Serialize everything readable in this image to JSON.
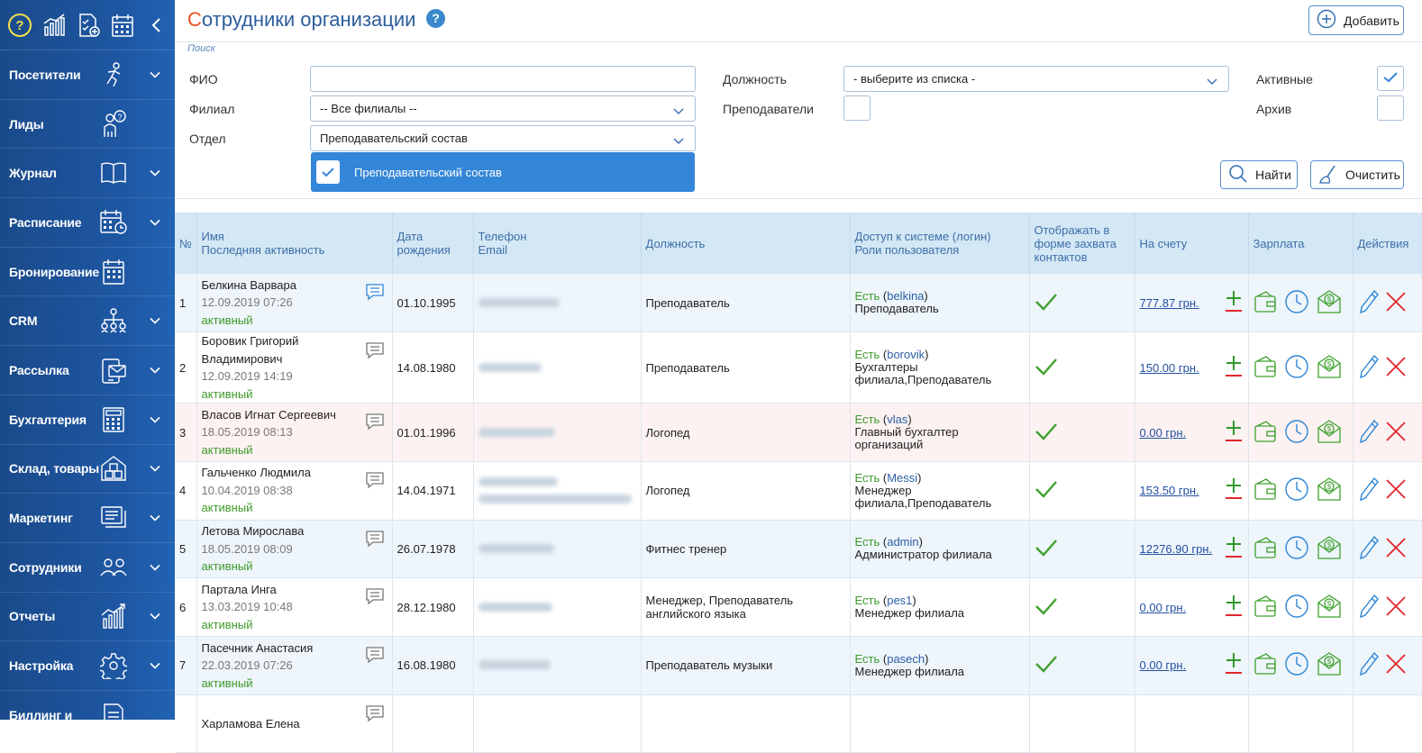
{
  "sidebar": {
    "items": [
      {
        "label": "Посетители",
        "icon": "visitor-icon",
        "chevron": true
      },
      {
        "label": "Лиды",
        "icon": "lead-icon",
        "chevron": false
      },
      {
        "label": "Журнал",
        "icon": "book-icon",
        "chevron": true
      },
      {
        "label": "Расписание",
        "icon": "schedule-icon",
        "chevron": true
      },
      {
        "label": "Бронирование",
        "icon": "booking-icon",
        "chevron": false
      },
      {
        "label": "CRM",
        "icon": "crm-icon",
        "chevron": true
      },
      {
        "label": "Рассылка",
        "icon": "mailing-icon",
        "chevron": true
      },
      {
        "label": "Бухгалтерия",
        "icon": "calculator-icon",
        "chevron": true
      },
      {
        "label": "Склад, товары",
        "icon": "warehouse-icon",
        "chevron": true
      },
      {
        "label": "Маркетинг",
        "icon": "marketing-icon",
        "chevron": true
      },
      {
        "label": "Сотрудники",
        "icon": "staff-icon",
        "chevron": true
      },
      {
        "label": "Отчеты",
        "icon": "reports-icon",
        "chevron": true
      },
      {
        "label": "Настройка",
        "icon": "settings-gear-icon",
        "chevron": true
      },
      {
        "label": "Биллинг и",
        "icon": "billing-icon",
        "chevron": false
      }
    ]
  },
  "header": {
    "title_first": "С",
    "title_rest": "отрудники организации",
    "help": "?",
    "add_label": "Добавить",
    "search_label": "Поиск"
  },
  "filters": {
    "fio_label": "ФИО",
    "fio_value": "",
    "branch_label": "Филиал",
    "branch_value": "-- Все филиалы --",
    "dept_label": "Отдел",
    "dept_value": "Преподавательский состав",
    "dept_option": "Преподавательский состав",
    "position_label": "Должность",
    "position_value": "- выберите из списка -",
    "teachers_label": "Преподаватели",
    "active_label": "Активные",
    "archive_label": "Архив",
    "find_label": "Найти",
    "clear_label": "Очистить"
  },
  "table": {
    "headers": {
      "num": "№",
      "name1": "Имя",
      "name2": "Последняя активность",
      "dob1": "Дата",
      "dob2": "рождения",
      "phone1": "Телефон",
      "phone2": "Email",
      "position": "Должность",
      "access1": "Доступ к системе (логин)",
      "access2": "Роли пользователя",
      "display": "Отображать в форме захвата контактов",
      "balance": "На счету",
      "salary": "Зарплата",
      "actions": "Действия"
    },
    "rows": [
      {
        "n": "1",
        "name": "Белкина Варвара",
        "last": "12.09.2019 07:26",
        "status": "активный",
        "dob": "01.10.1995",
        "position": "Преподаватель",
        "access": "Есть",
        "login": "belkina",
        "role": "Преподаватель",
        "balance": "777.87 грн."
      },
      {
        "n": "2",
        "name": "Боровик Григорий Владимирович",
        "last": "12.09.2019 14:19",
        "status": "активный",
        "dob": "14.08.1980",
        "position": "Преподаватель",
        "access": "Есть",
        "login": "borovik",
        "role": "Бухгалтеры филиала,Преподаватель",
        "balance": "150.00 грн."
      },
      {
        "n": "3",
        "name": "Власов Игнат Сергеевич",
        "last": "18.05.2019 08:13",
        "status": "активный",
        "dob": "01.01.1996",
        "position": "Логопед",
        "access": "Есть",
        "login": "vlas",
        "role": "Главный бухгалтер организаций",
        "balance": "0.00 грн."
      },
      {
        "n": "4",
        "name": "Гальченко Людмила",
        "last": "10.04.2019 08:38",
        "status": "активный",
        "dob": "14.04.1971",
        "position": "Логопед",
        "access": "Есть",
        "login": "Messi",
        "role": "Менеджер филиала,Преподаватель",
        "balance": "153.50 грн."
      },
      {
        "n": "5",
        "name": "Летова Мирослава",
        "last": "18.05.2019 08:09",
        "status": "активный",
        "dob": "26.07.1978",
        "position": "Фитнес тренер",
        "access": "Есть",
        "login": "admin",
        "role": "Администратор филиала",
        "balance": "12276.90 грн."
      },
      {
        "n": "6",
        "name": "Партала Инга",
        "last": "13.03.2019 10:48",
        "status": "активный",
        "dob": "28.12.1980",
        "position": "Менеджер, Преподаватель английского языка",
        "access": "Есть",
        "login": "pes1",
        "role": "Менеджер филиала",
        "balance": "0.00 грн."
      },
      {
        "n": "7",
        "name": "Пасечник Анастасия",
        "last": "22.03.2019 07:26",
        "status": "активный",
        "dob": "16.08.1980",
        "position": "Преподаватель музыки",
        "access": "Есть",
        "login": "pasech",
        "role": "Менеджер филиала",
        "balance": "0.00 грн."
      },
      {
        "n": "",
        "name": "Харламова Елена",
        "last": "",
        "status": "",
        "dob": "",
        "position": "",
        "access": "",
        "login": "",
        "role": "",
        "balance": ""
      }
    ]
  },
  "colors": {
    "sidebar": "#1e57a3",
    "header_row": "#d3e7f5",
    "accent": "#3486d8",
    "ok": "#3e9a2c",
    "delete": "#e2262d"
  }
}
